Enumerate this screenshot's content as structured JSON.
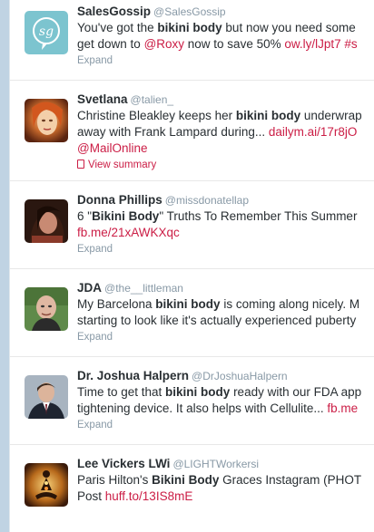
{
  "tweets": [
    {
      "fullname": "SalesGossip",
      "username": "@SalesGossip",
      "line1": [
        {
          "t": "You've got the "
        },
        {
          "t": "bikini body",
          "b": true
        },
        {
          "t": " but now you need some"
        }
      ],
      "line2": [
        {
          "t": "get down to "
        },
        {
          "t": "@Roxy",
          "l": true
        },
        {
          "t": " now to save 50%  "
        },
        {
          "t": "ow.ly/lJpt7",
          "l": true
        },
        {
          "t": " "
        },
        {
          "t": "#s",
          "l": true
        }
      ],
      "action": "Expand",
      "avatar": "sg-logo",
      "avatar_color": "#7cc4cf"
    },
    {
      "fullname": "Svetlana",
      "username": "@talien_",
      "line1": [
        {
          "t": "Christine Bleakley keeps her "
        },
        {
          "t": "bikini body",
          "b": true
        },
        {
          "t": " underwrap"
        }
      ],
      "line2": [
        {
          "t": "away with Frank Lampard during... "
        },
        {
          "t": "dailym.ai/17r8jO",
          "l": true
        }
      ],
      "line3": [
        {
          "t": "@MailOnline",
          "l": true
        }
      ],
      "action": "View summary",
      "action_icon": "document-icon",
      "avatar": "photo-woman-red-hair"
    },
    {
      "fullname": "Donna Phillips",
      "username": "@missdonatellap",
      "line1": [
        {
          "t": "6 \""
        },
        {
          "t": "Bikini Body",
          "b": true
        },
        {
          "t": "\" Truths To Remember This Summer"
        }
      ],
      "line2": [
        {
          "t": "fb.me/21xAWKXqc",
          "l": true
        }
      ],
      "action": "Expand",
      "avatar": "photo-woman-dark-hair"
    },
    {
      "fullname": "JDA",
      "username": "@the__littleman",
      "line1": [
        {
          "t": "My Barcelona "
        },
        {
          "t": "bikini body",
          "b": true
        },
        {
          "t": " is coming along nicely. M"
        }
      ],
      "line2": [
        {
          "t": "starting to look like it's actually experienced puberty"
        }
      ],
      "action": "Expand",
      "avatar": "photo-bald-man"
    },
    {
      "fullname": "Dr. Joshua Halpern",
      "username": "@DrJoshuaHalpern",
      "line1": [
        {
          "t": "Time to get that "
        },
        {
          "t": "bikini body",
          "b": true
        },
        {
          "t": " ready with our FDA app"
        }
      ],
      "line2": [
        {
          "t": "tightening device. It also helps with Cellulite... "
        },
        {
          "t": "fb.me",
          "l": true
        }
      ],
      "action": "Expand",
      "avatar": "photo-man-suit"
    },
    {
      "fullname": "Lee Vickers LWi",
      "username": "@LIGHTWorkersi",
      "line1": [
        {
          "t": "Paris Hilton's "
        },
        {
          "t": "Bikini Body",
          "b": true
        },
        {
          "t": " Graces Instagram (PHOT"
        }
      ],
      "line2": [
        {
          "t": "Post "
        },
        {
          "t": "huff.to/13IS8mE",
          "l": true
        }
      ],
      "action": "",
      "avatar": "meditation-figure-art"
    }
  ],
  "colors": {
    "link": "#cb1d45",
    "meta": "#8899a6",
    "text": "#292f33",
    "page_bg": "#c0d3e3"
  }
}
